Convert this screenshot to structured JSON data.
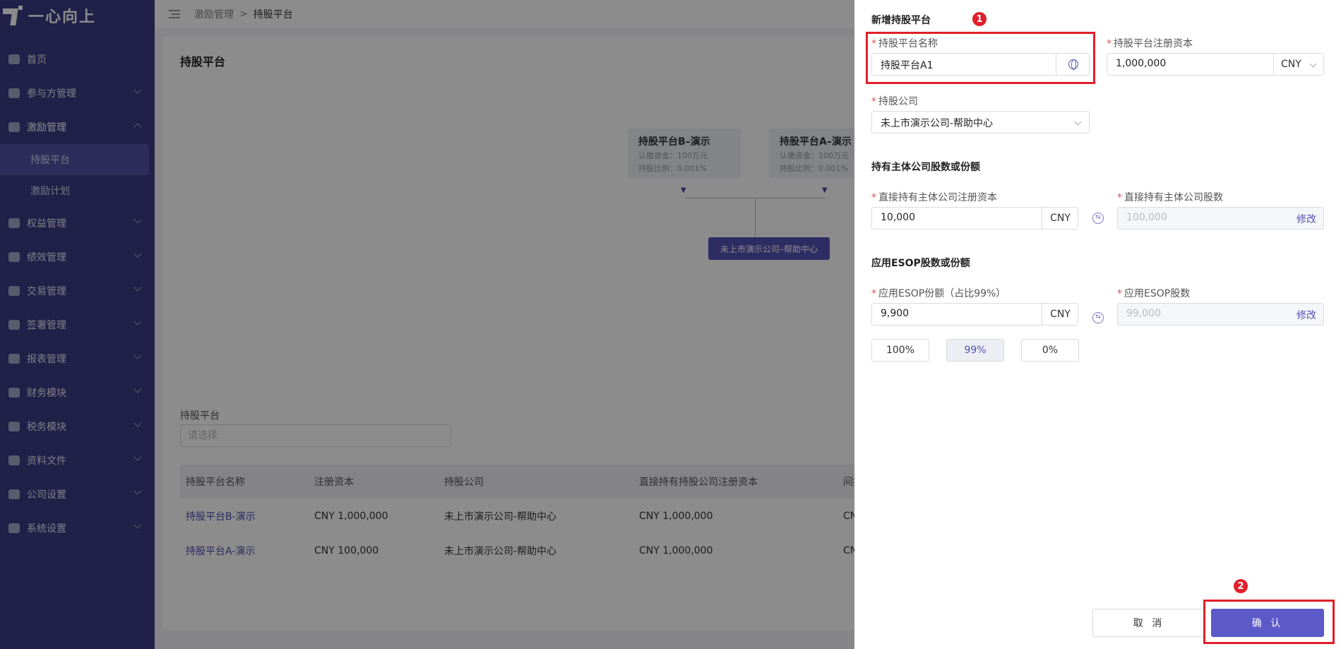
{
  "sidebar": {
    "logo_text": "一心向上",
    "items": [
      {
        "label": "首页"
      },
      {
        "label": "参与方管理"
      },
      {
        "label": "激励管理"
      },
      {
        "label": "持股平台"
      },
      {
        "label": "激励计划"
      },
      {
        "label": "权益管理"
      },
      {
        "label": "绩效管理"
      },
      {
        "label": "交易管理"
      },
      {
        "label": "签署管理"
      },
      {
        "label": "报表管理"
      },
      {
        "label": "财务模块"
      },
      {
        "label": "税务模块"
      },
      {
        "label": "资料文件"
      },
      {
        "label": "公司设置"
      },
      {
        "label": "系统设置"
      }
    ]
  },
  "breadcrumb": {
    "parent": "激励管理",
    "sep": ">",
    "current": "持股平台"
  },
  "page": {
    "title": "持股平台",
    "org": {
      "nodes": [
        {
          "title": "持股平台B–演示",
          "line1": "认缴资金：100万元",
          "line2": "持股比例：0.001%"
        },
        {
          "title": "持股平台A–演示",
          "line1": "认缴资金：100万元",
          "line2": "持股比例：0.001%"
        }
      ],
      "root": "未上市演示公司–帮助中心"
    },
    "filter": {
      "label": "持股平台",
      "placeholder": "请选择"
    },
    "table": {
      "headers": [
        "持股平台名称",
        "注册资本",
        "持股公司",
        "直接持有持股公司注册资本",
        "间接"
      ],
      "rows": [
        [
          "持股平台B-演示",
          "CNY 1,000,000",
          "未上市演示公司-帮助中心",
          "CNY 1,000,000",
          "CN"
        ],
        [
          "持股平台A-演示",
          "CNY 100,000",
          "未上市演示公司-帮助中心",
          "CNY 1,000,000",
          "CN"
        ]
      ]
    }
  },
  "drawer": {
    "title": "新增持股平台",
    "name_label": "持股平台名称",
    "name_value": "持股平台A1",
    "capital_label": "持股平台注册资本",
    "capital_value": "1,000,000",
    "capital_currency": "CNY",
    "company_label": "持股公司",
    "company_value": "未上市演示公司-帮助中心",
    "section1_title": "持有主体公司股数或份额",
    "direct_capital_label": "直接持有主体公司注册资本",
    "direct_capital_value": "10,000",
    "direct_capital_currency": "CNY",
    "direct_shares_label": "直接持有主体公司股数",
    "direct_shares_value": "100,000",
    "edit_label": "修改",
    "section2_title": "应用ESOP股数或份额",
    "esop_amount_label": "应用ESOP份额（占比99%）",
    "esop_amount_value": "9,900",
    "esop_currency": "CNY",
    "esop_shares_label": "应用ESOP股数",
    "esop_shares_value": "99,000",
    "pct_buttons": [
      "100%",
      "99%",
      "0%"
    ],
    "cancel_label": "取 消",
    "confirm_label": "确 认"
  },
  "annotations": {
    "marker1": "1",
    "marker2": "2",
    "highlight_color": "#e0202a"
  },
  "colors": {
    "sidebar_bg": "#3d3b85",
    "accent": "#5c59c9"
  }
}
